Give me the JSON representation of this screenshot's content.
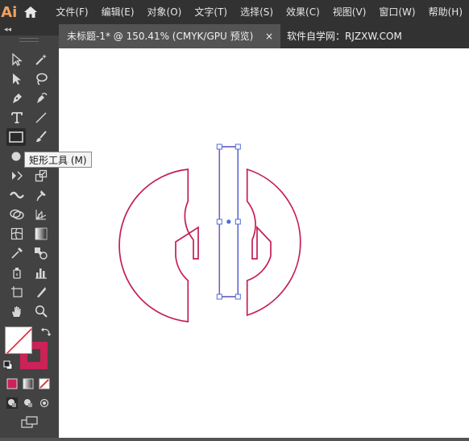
{
  "app": {
    "logo_text": "Ai"
  },
  "menu": [
    "文件(F)",
    "编辑(E)",
    "对象(O)",
    "文字(T)",
    "选择(S)",
    "效果(C)",
    "视图(V)",
    "窗口(W)",
    "帮助(H)"
  ],
  "tabs": {
    "active_label": "未标题-1* @ 150.41% (CMYK/GPU 预览)",
    "close_glyph": "×",
    "other_label": "软件自学网：RJZXW.COM"
  },
  "toolpanel": {
    "collapse_glyph": "◂◂"
  },
  "tooltip": {
    "text": "矩形工具 (M)"
  },
  "colors": {
    "shape_stroke": "#c41e55",
    "selection": "#4f6ddb",
    "stroke_swatch": "#cc2257"
  },
  "tools": [
    "selection-tool-icon",
    "magic-wand-icon",
    "direct-selection-icon",
    "lasso-icon",
    "pen-icon",
    "curvature-icon",
    "type-icon",
    "line-segment-icon",
    "rectangle-icon",
    "paintbrush-icon",
    "shaper-icon",
    "eraser-icon",
    "rotate-icon",
    "scale-icon",
    "width-icon",
    "puppet-warp-icon",
    "shape-builder-icon",
    "perspective-grid-icon",
    "mesh-icon",
    "gradient-icon",
    "eyedropper-icon",
    "blend-icon",
    "symbol-sprayer-icon",
    "column-graph-icon",
    "artboard-icon",
    "slice-icon",
    "hand-icon",
    "zoom-icon"
  ]
}
